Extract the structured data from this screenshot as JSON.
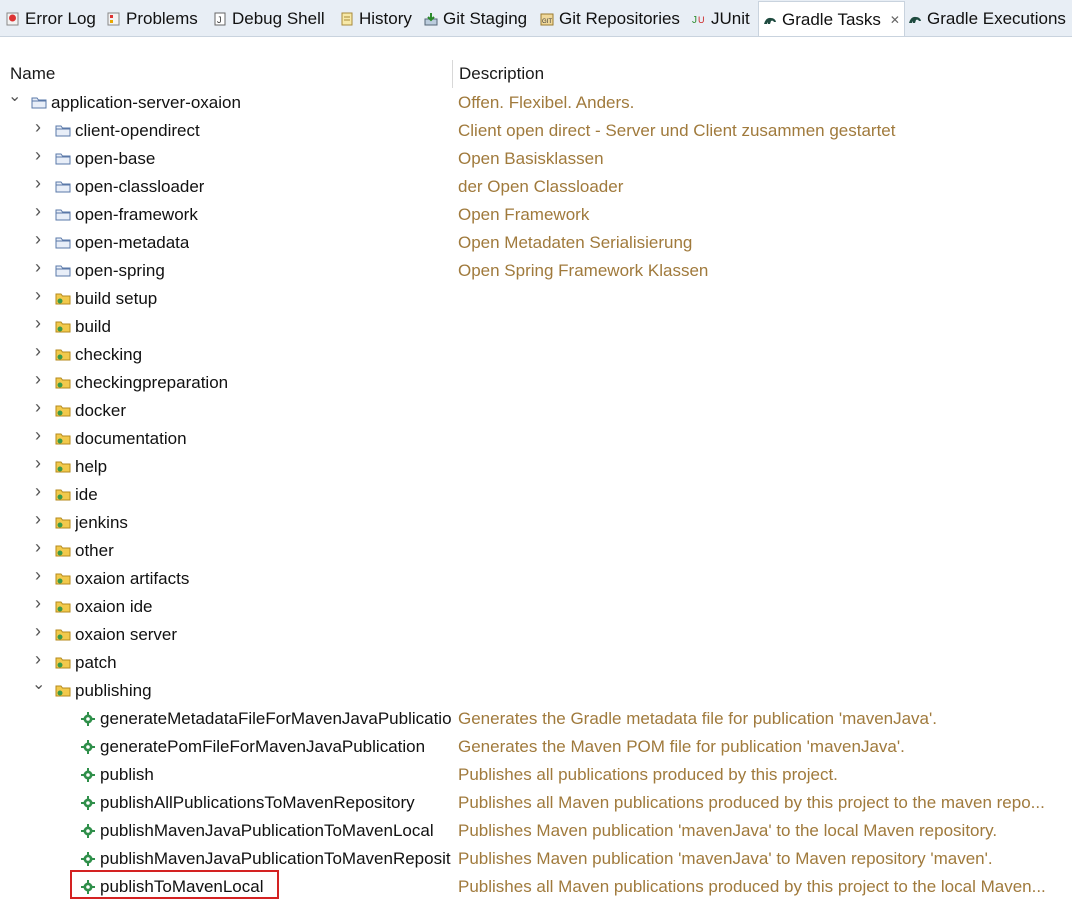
{
  "tabs": [
    {
      "label": "Error Log",
      "icon": "error-log-icon"
    },
    {
      "label": "Problems",
      "icon": "problems-icon"
    },
    {
      "label": "Debug Shell",
      "icon": "debug-shell-icon"
    },
    {
      "label": "History",
      "icon": "history-icon"
    },
    {
      "label": "Git Staging",
      "icon": "git-staging-icon"
    },
    {
      "label": "Git Repositories",
      "icon": "git-repositories-icon"
    },
    {
      "label": "JUnit",
      "icon": "junit-icon"
    },
    {
      "label": "Gradle Tasks",
      "icon": "gradle-icon",
      "active": true,
      "close": "✕"
    },
    {
      "label": "Gradle Executions",
      "icon": "gradle-icon"
    }
  ],
  "columns": {
    "name": "Name",
    "description": "Description"
  },
  "tree": [
    {
      "name": "application-server-oxaion",
      "desc": "Offen. Flexibel. Anders.",
      "kind": "project",
      "expanded": true
    },
    {
      "name": "client-opendirect",
      "desc": "Client open direct - Server und Client zusammen gestartet",
      "kind": "project"
    },
    {
      "name": "open-base",
      "desc": "Open Basisklassen",
      "kind": "project"
    },
    {
      "name": "open-classloader",
      "desc": "der Open Classloader",
      "kind": "project"
    },
    {
      "name": "open-framework",
      "desc": "Open Framework",
      "kind": "project"
    },
    {
      "name": "open-metadata",
      "desc": "Open Metadaten Serialisierung",
      "kind": "project"
    },
    {
      "name": "open-spring",
      "desc": "Open Spring Framework Klassen",
      "kind": "project"
    },
    {
      "name": "build setup",
      "desc": "",
      "kind": "group"
    },
    {
      "name": "build",
      "desc": "",
      "kind": "group"
    },
    {
      "name": "checking",
      "desc": "",
      "kind": "group"
    },
    {
      "name": "checkingpreparation",
      "desc": "",
      "kind": "group"
    },
    {
      "name": "docker",
      "desc": "",
      "kind": "group"
    },
    {
      "name": "documentation",
      "desc": "",
      "kind": "group"
    },
    {
      "name": "help",
      "desc": "",
      "kind": "group"
    },
    {
      "name": "ide",
      "desc": "",
      "kind": "group"
    },
    {
      "name": "jenkins",
      "desc": "",
      "kind": "group"
    },
    {
      "name": "other",
      "desc": "",
      "kind": "group"
    },
    {
      "name": "oxaion artifacts",
      "desc": "",
      "kind": "group"
    },
    {
      "name": "oxaion ide",
      "desc": "",
      "kind": "group"
    },
    {
      "name": "oxaion server",
      "desc": "",
      "kind": "group"
    },
    {
      "name": "patch",
      "desc": "",
      "kind": "group"
    },
    {
      "name": "publishing",
      "desc": "",
      "kind": "group",
      "expanded": true
    },
    {
      "name": "generateMetadataFileForMavenJavaPublication",
      "desc": "Generates the Gradle metadata file for publication 'mavenJava'.",
      "kind": "task"
    },
    {
      "name": "generatePomFileForMavenJavaPublication",
      "desc": "Generates the Maven POM file for publication 'mavenJava'.",
      "kind": "task"
    },
    {
      "name": "publish",
      "desc": "Publishes all publications produced by this project.",
      "kind": "task"
    },
    {
      "name": "publishAllPublicationsToMavenRepository",
      "desc": "Publishes all Maven publications produced by this project to the maven repo...",
      "kind": "task"
    },
    {
      "name": "publishMavenJavaPublicationToMavenLocal",
      "desc": "Publishes Maven publication 'mavenJava' to the local Maven repository.",
      "kind": "task"
    },
    {
      "name": "publishMavenJavaPublicationToMavenRepository",
      "desc": "Publishes Maven publication 'mavenJava' to Maven repository 'maven'.",
      "kind": "task"
    },
    {
      "name": "publishToMavenLocal",
      "desc": "Publishes all Maven publications produced by this project to the local Maven...",
      "kind": "task",
      "selected": true
    }
  ],
  "icons": {
    "expanded": "chevron-down-icon",
    "collapsed": "chevron-right-icon",
    "project": "project-folder-icon",
    "group": "task-group-folder-icon",
    "task": "gradle-task-icon"
  },
  "colors": {
    "description": "#a07a3c",
    "selection": "#d42222",
    "tabbar": "#e8eef5"
  }
}
